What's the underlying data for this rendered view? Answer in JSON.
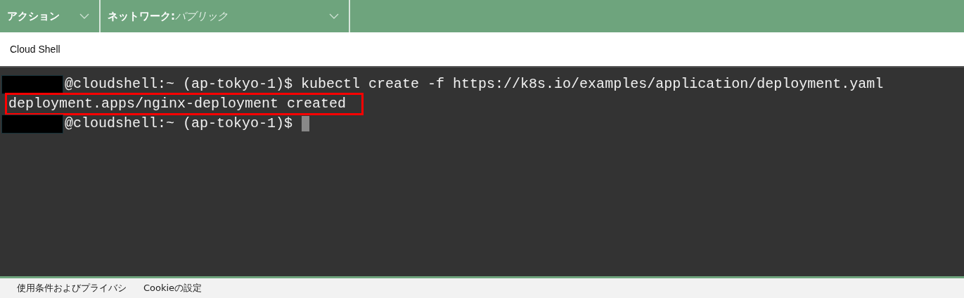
{
  "toolbar": {
    "menus": [
      {
        "label": "アクション"
      },
      {
        "label": "ネットワーク:",
        "value": "パブリック"
      }
    ]
  },
  "panel": {
    "title": "Cloud Shell"
  },
  "terminal": {
    "lines": [
      {
        "kind": "prompt",
        "text": "@cloudshell:~ (ap-tokyo-1)$ kubectl create -f https://k8s.io/examples/application/deployment.yaml",
        "highlighted": false,
        "cursor": false
      },
      {
        "kind": "output",
        "text": "deployment.apps/nginx-deployment created",
        "highlighted": true,
        "cursor": false
      },
      {
        "kind": "prompt",
        "text": "@cloudshell:~ (ap-tokyo-1)$",
        "highlighted": false,
        "cursor": true
      }
    ]
  },
  "footer": {
    "links": [
      {
        "label": "使用条件およびプライバシ"
      },
      {
        "label": "Cookieの設定"
      }
    ]
  }
}
